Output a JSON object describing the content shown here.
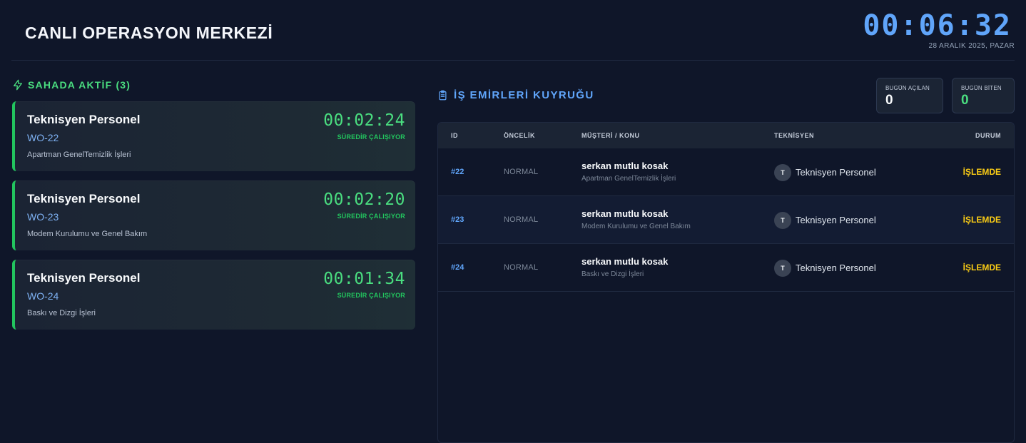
{
  "header": {
    "title": "CANLI OPERASYON MERKEZİ",
    "clock": "00:06:32",
    "date": "28 ARALIK 2025, PAZAR"
  },
  "active": {
    "title": "SAHADA AKTİF (3)",
    "accent_color": "#4ade80",
    "cards": [
      {
        "name": "Teknisyen Personel",
        "wo": "WO-22",
        "desc": "Apartman GenelTemizlik İşleri",
        "timer": "00:02:24",
        "status": "SÜREDİR ÇALIŞIYOR"
      },
      {
        "name": "Teknisyen Personel",
        "wo": "WO-23",
        "desc": "Modem Kurulumu ve Genel Bakım",
        "timer": "00:02:20",
        "status": "SÜREDİR ÇALIŞIYOR"
      },
      {
        "name": "Teknisyen Personel",
        "wo": "WO-24",
        "desc": "Baskı ve Dizgi İşleri",
        "timer": "00:01:34",
        "status": "SÜREDİR ÇALIŞIYOR"
      }
    ]
  },
  "queue": {
    "title": "İŞ EMİRLERİ KUYRUĞU",
    "stats": {
      "opened_label": "BUGÜN AÇILAN",
      "opened_value": "0",
      "closed_label": "BUGÜN BİTEN",
      "closed_value": "0"
    },
    "columns": {
      "id": "ID",
      "priority": "ÖNCELİK",
      "customer": "MÜŞTERİ / KONU",
      "technician": "TEKNİSYEN",
      "status": "DURUM"
    },
    "rows": [
      {
        "id": "#22",
        "priority": "NORMAL",
        "customer": "serkan mutlu kosak",
        "subject": "Apartman GenelTemizlik İşleri",
        "avatar": "T",
        "technician": "Teknisyen Personel",
        "status": "İŞLEMDE"
      },
      {
        "id": "#23",
        "priority": "NORMAL",
        "customer": "serkan mutlu kosak",
        "subject": "Modem Kurulumu ve Genel Bakım",
        "avatar": "T",
        "technician": "Teknisyen Personel",
        "status": "İŞLEMDE"
      },
      {
        "id": "#24",
        "priority": "NORMAL",
        "customer": "serkan mutlu kosak",
        "subject": "Baskı ve Dizgi İşleri",
        "avatar": "T",
        "technician": "Teknisyen Personel",
        "status": "İŞLEMDE"
      }
    ]
  },
  "colors": {
    "background": "#0f1629",
    "clock": "#60a5fa",
    "active_green": "#22c55e",
    "status_yellow": "#facc15"
  },
  "icons": {
    "active": "lightning-icon",
    "queue": "clipboard-icon"
  }
}
